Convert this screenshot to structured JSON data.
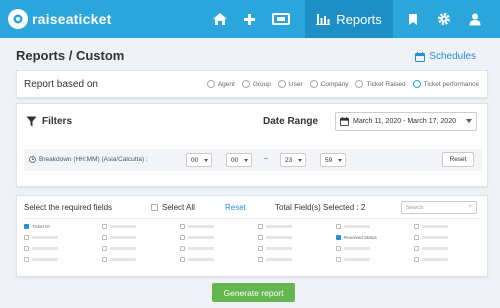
{
  "app": {
    "brand": "raiseaticket"
  },
  "nav": {
    "reports_label": "Reports"
  },
  "page": {
    "title": "Reports / Custom",
    "schedules_label": "Schedules"
  },
  "report_based_on": {
    "label": "Report based on",
    "options": [
      "Agent",
      "Group",
      "User",
      "Company",
      "Ticket Raised",
      "Ticket performance"
    ],
    "selected": "Ticket performance"
  },
  "filters": {
    "title": "Filters",
    "date_range_label": "Date Range",
    "date_range_value": "March 11, 2020 - March 17, 2020",
    "breakdown_label": "Breakdown (HH:MM) (Asia/Calcutta) :",
    "from_hh": "00",
    "from_mm": "00",
    "dash": "–",
    "to_hh": "23",
    "to_mm": "59",
    "reset_label": "Reset"
  },
  "fields": {
    "label": "Select the required fields",
    "select_all_label": "Select All",
    "reset_label": "Reset",
    "total_label": "Total Field(s) Selected : 2",
    "search_placeholder": "Search",
    "search_clear": "×",
    "checked": [
      "Ticket ID",
      "Resolved Status"
    ]
  },
  "footer": {
    "generate_label": "Generate report"
  },
  "colors": {
    "topbar": "#2aa6dc",
    "active_tab": "#1e8fc4",
    "accent": "#2a8fd4",
    "generate": "#64b64f"
  }
}
